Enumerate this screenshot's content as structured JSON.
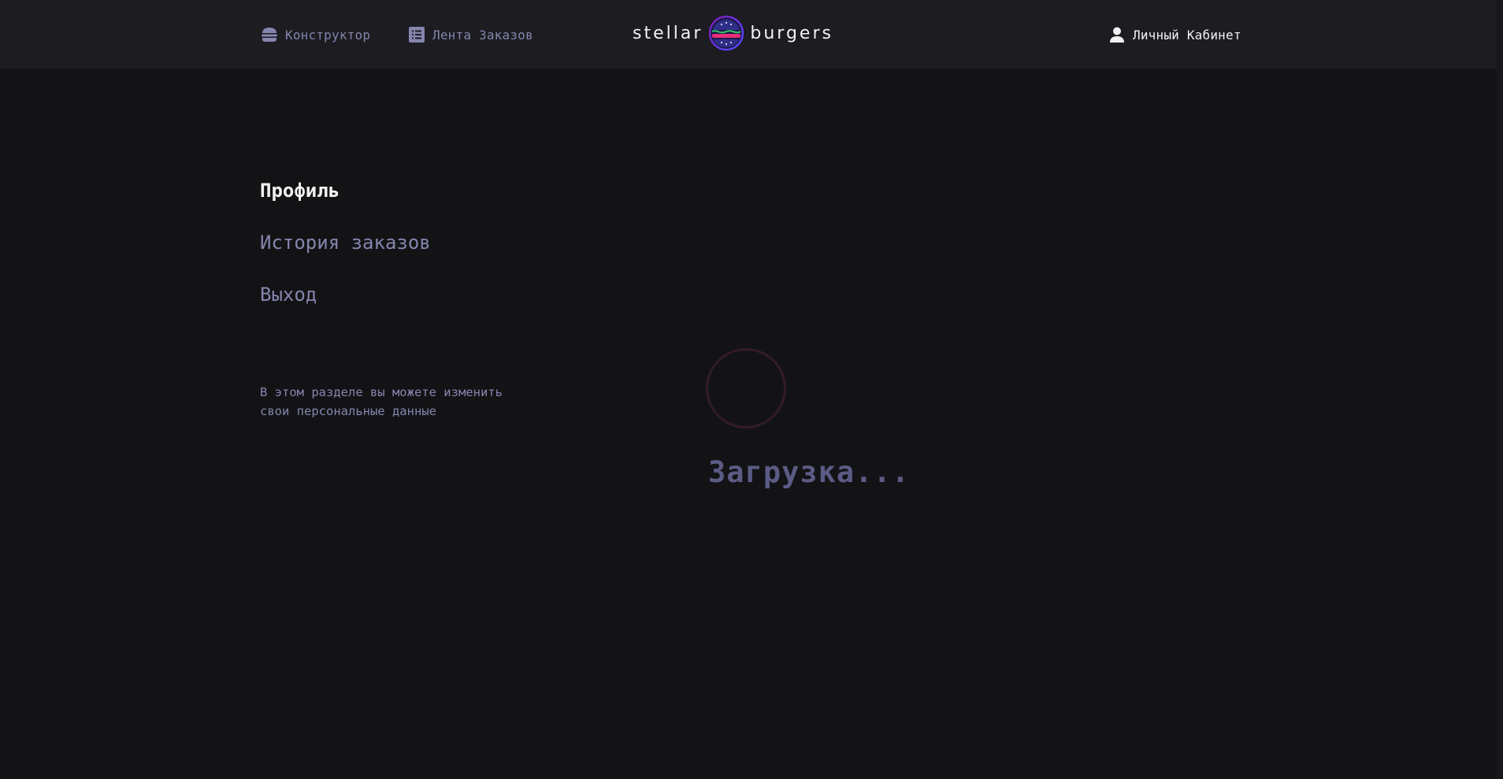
{
  "header": {
    "nav": {
      "constructor_label": "Конструктор",
      "constructor_icon": "burger-icon",
      "feed_label": "Лента Заказов",
      "feed_icon": "list-icon",
      "account_label": "Личный Кабинет",
      "account_icon": "profile-icon"
    },
    "logo": {
      "left_word": "stellar",
      "right_word": "burgers",
      "icon": "burger-logo-icon"
    }
  },
  "profile_menu": {
    "items": [
      {
        "label": "Профиль",
        "active": true
      },
      {
        "label": "История заказов",
        "active": false
      },
      {
        "label": "Выход",
        "active": false
      }
    ],
    "hint": "В этом разделе вы можете изменить\nсвои персональные данные"
  },
  "loader": {
    "text": "Загрузка..."
  },
  "colors": {
    "background": "#131316",
    "header_background": "#1c1c21",
    "text_primary": "#f2f2f3",
    "text_inactive": "#8585ad",
    "loading_text": "#5b5b85",
    "spinner_ring": "#331c26",
    "logo_accent_purple": "#4c4cff",
    "logo_accent_pink": "#e62e79"
  }
}
